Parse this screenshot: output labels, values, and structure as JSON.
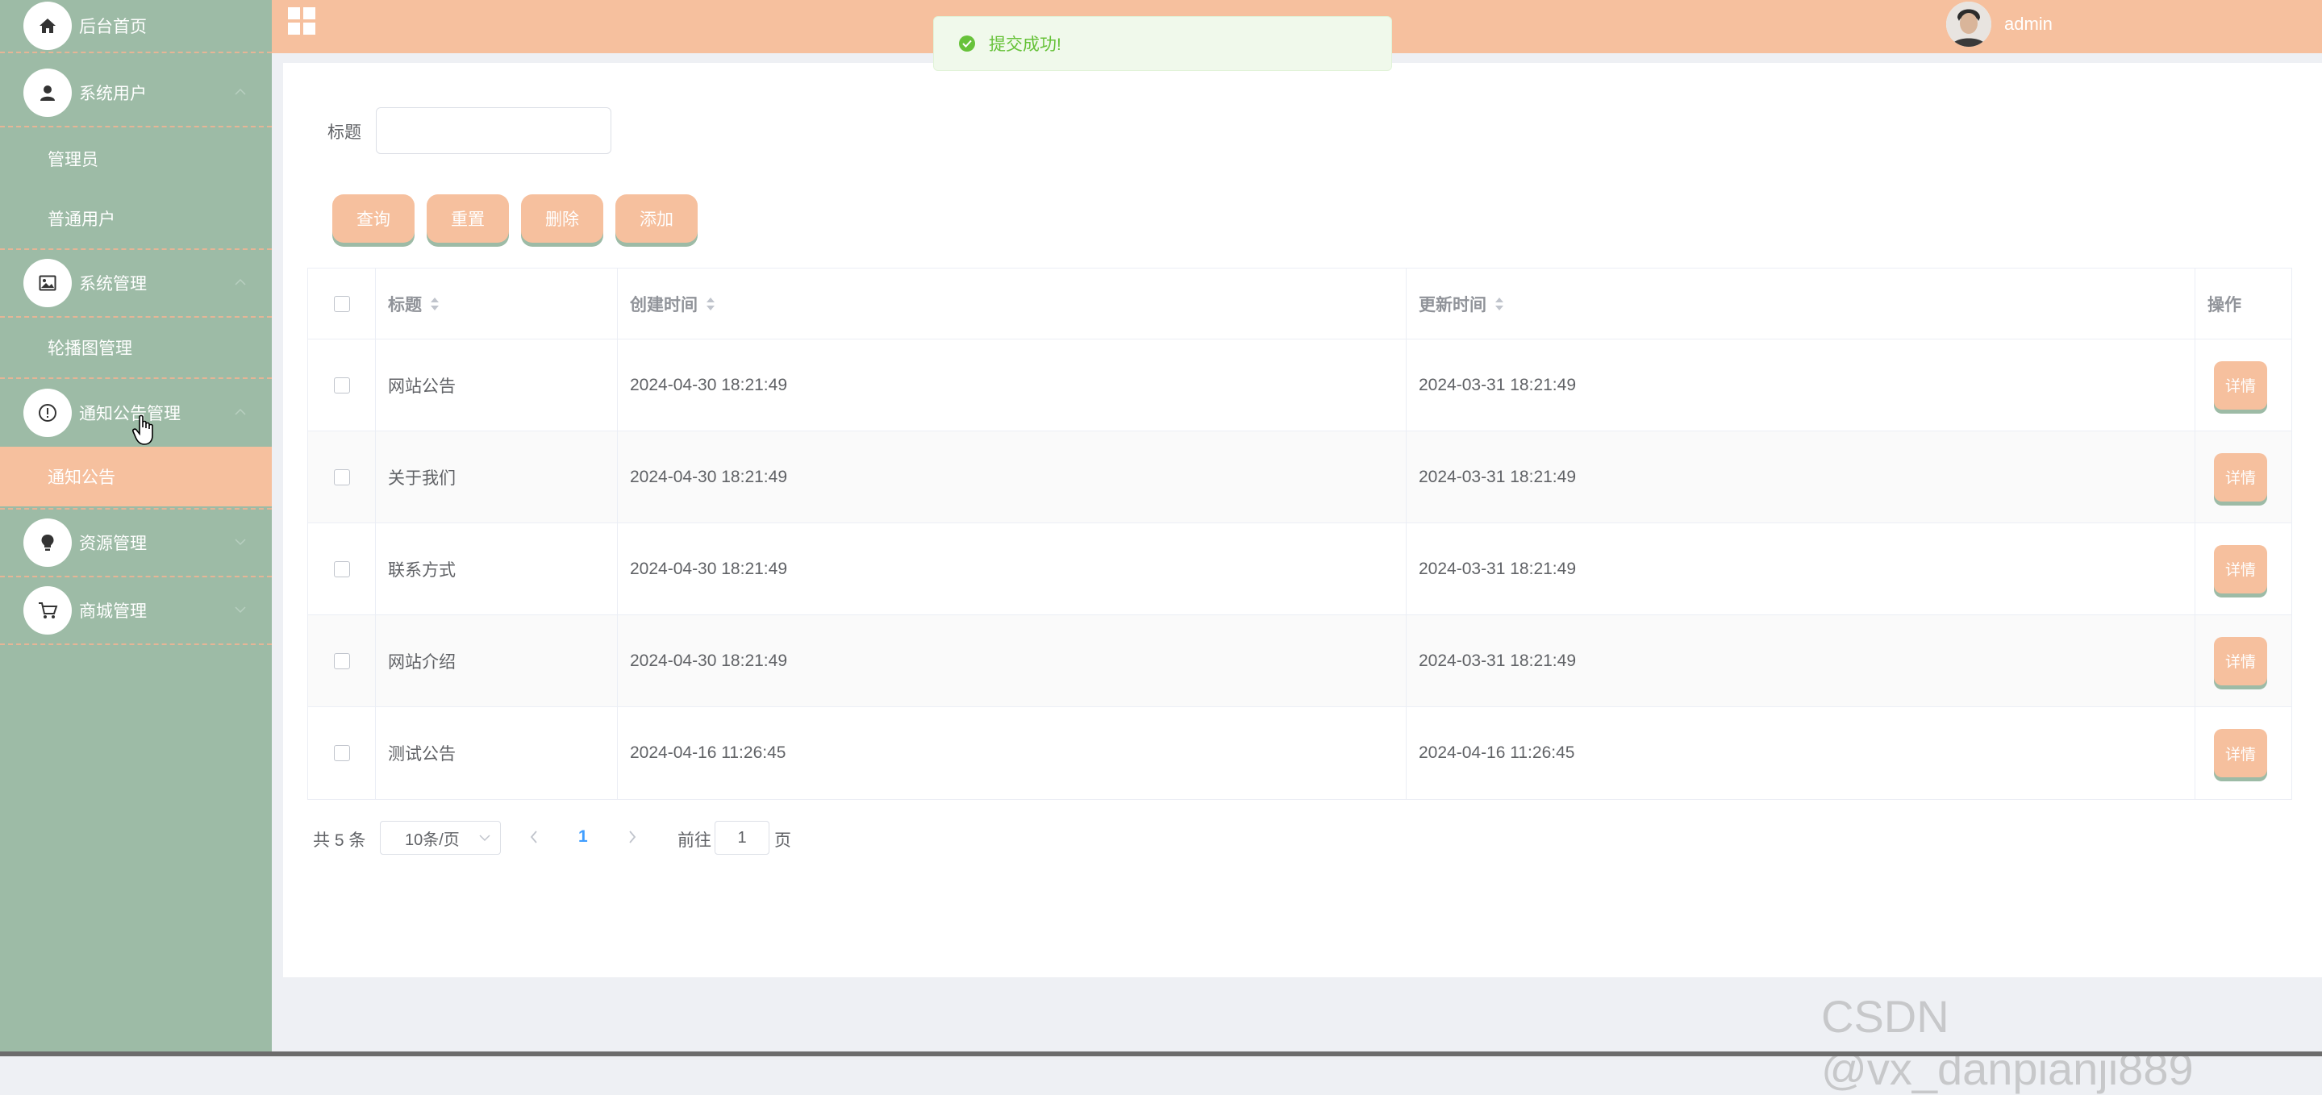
{
  "header": {
    "system_title": "",
    "username": "admin"
  },
  "toast": {
    "message": "提交成功!"
  },
  "sidebar": {
    "items": [
      {
        "label": "后台首页",
        "icon": "home-icon"
      },
      {
        "label": "系统用户",
        "icon": "user-icon",
        "children": [
          "管理员",
          "普通用户"
        ]
      },
      {
        "label": "系统管理",
        "icon": "image-icon",
        "children": [
          "轮播图管理"
        ]
      },
      {
        "label": "通知公告管理",
        "icon": "info-circle-icon",
        "children": [
          "通知公告"
        ],
        "active_child": "通知公告"
      },
      {
        "label": "资源管理",
        "icon": "bulb-icon"
      },
      {
        "label": "商城管理",
        "icon": "cart-icon"
      }
    ]
  },
  "search": {
    "label": "标题",
    "value": "",
    "placeholder": ""
  },
  "buttons": {
    "query": "查询",
    "reset": "重置",
    "delete": "删除",
    "add": "添加"
  },
  "table": {
    "columns": [
      "标题",
      "创建时间",
      "更新时间",
      "操作"
    ],
    "rows": [
      {
        "title": "网站公告",
        "created": "2024-04-30 18:21:49",
        "updated": "2024-03-31 18:21:49",
        "action": "详情"
      },
      {
        "title": "关于我们",
        "created": "2024-04-30 18:21:49",
        "updated": "2024-03-31 18:21:49",
        "action": "详情"
      },
      {
        "title": "联系方式",
        "created": "2024-04-30 18:21:49",
        "updated": "2024-03-31 18:21:49",
        "action": "详情"
      },
      {
        "title": "网站介绍",
        "created": "2024-04-30 18:21:49",
        "updated": "2024-03-31 18:21:49",
        "action": "详情"
      },
      {
        "title": "测试公告",
        "created": "2024-04-16 11:26:45",
        "updated": "2024-04-16 11:26:45",
        "action": "详情"
      }
    ]
  },
  "pagination": {
    "total_text": "共 5 条",
    "page_size": "10条/页",
    "current_page": "1",
    "goto_label": "前往",
    "goto_value": "1",
    "page_suffix": "页"
  },
  "watermark": "CSDN @vx_danpianji889",
  "colors": {
    "sidebar": "#9dbba6",
    "accent": "#f6c09e",
    "success": "#67c23a",
    "link": "#409eff"
  }
}
